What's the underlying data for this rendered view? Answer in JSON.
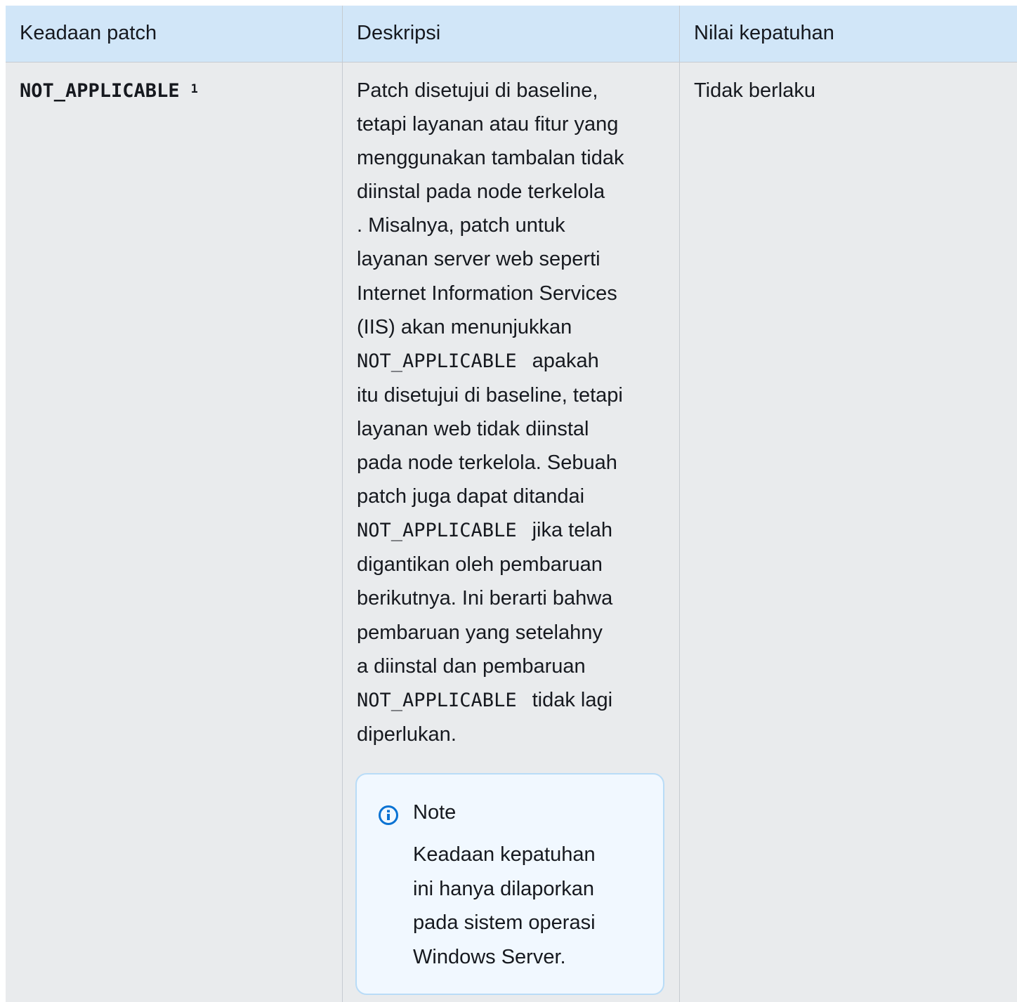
{
  "table": {
    "headers": [
      "Keadaan patch",
      "Deskripsi",
      "Nilai kepatuhan"
    ],
    "row": {
      "state": "NOT_APPLICABLE",
      "footnote_marker": "1",
      "description_lines": [
        {
          "text": "Patch disetujui di baseline,"
        },
        {
          "text": "tetapi layanan atau fitur yang"
        },
        {
          "text": "menggunakan tambalan tidak"
        },
        {
          "text": "diinstal pada node terkelola"
        },
        {
          "text": ". Misalnya, patch untuk"
        },
        {
          "text": "layanan server web seperti"
        },
        {
          "text": "Internet Information Services"
        },
        {
          "text": "(IIS) akan menunjukkan"
        },
        {
          "code": "NOT_APPLICABLE",
          "text": "apakah"
        },
        {
          "text": "itu disetujui di baseline, tetapi"
        },
        {
          "text": "layanan web tidak diinstal"
        },
        {
          "text": "pada node terkelola. Sebuah"
        },
        {
          "text": "patch juga dapat ditandai"
        },
        {
          "code": "NOT_APPLICABLE",
          "text": "jika telah"
        },
        {
          "text": "digantikan oleh pembaruan"
        },
        {
          "text": "berikutnya. Ini berarti bahwa"
        },
        {
          "text": "pembaruan yang setelahny"
        },
        {
          "text": "a diinstal dan pembaruan"
        },
        {
          "code": "NOT_APPLICABLE",
          "text": "tidak lagi"
        },
        {
          "text": "diperlukan."
        }
      ],
      "note": {
        "icon": "info-icon",
        "title": "Note",
        "body_lines": [
          "Keadaan kepatuhan",
          "ini hanya dilaporkan",
          "pada sistem operasi",
          "Windows Server."
        ]
      },
      "value": "Tidak berlaku"
    }
  },
  "colors": {
    "header_bg": "#d1e6f8",
    "body_bg": "#e9ebed",
    "note_bg": "#f1f8ff",
    "note_border": "#b9dcf7",
    "info_icon": "#0972d3"
  }
}
